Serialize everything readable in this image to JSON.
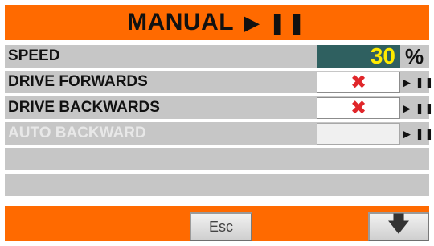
{
  "header": {
    "title": "MANUAL",
    "icon": "▶ ❚❚"
  },
  "rows": [
    {
      "label": "SPEED",
      "value": "30",
      "unit": "%",
      "enabled": true
    },
    {
      "label": "DRIVE FORWARDS",
      "state_icon": "✖",
      "play_icon": "▶ ❚❚",
      "enabled": true
    },
    {
      "label": "DRIVE BACKWARDS",
      "state_icon": "✖",
      "play_icon": "▶ ❚❚",
      "enabled": true
    },
    {
      "label": "AUTO BACKWARD",
      "play_icon": "▶ ❚❚",
      "enabled": false
    }
  ],
  "footer": {
    "esc_label": "Esc",
    "down_icon": "🡇"
  },
  "colors": {
    "accent": "#ff6a00",
    "row_bg": "#c6c6c6",
    "speed_bg": "#2f6060",
    "speed_text": "#ffea00",
    "cross": "#e0262a"
  }
}
